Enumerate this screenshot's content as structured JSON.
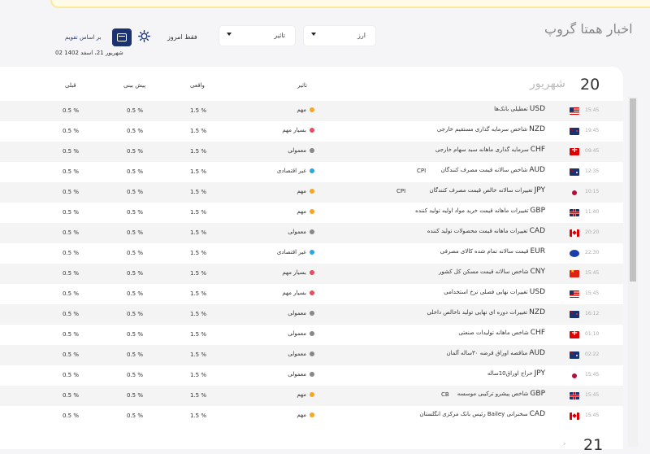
{
  "header": {
    "app_title": "اخبار همتا گروپ",
    "currency_select": "ارز",
    "impact_select": "تاثیر",
    "today_filter": "فقط امروز",
    "by_calendar": "بر اساس تقویم",
    "current_date": "02 شهریور 21، اسفد 1402"
  },
  "columns": {
    "impact": "تاثیر",
    "actual": "واقعی",
    "forecast": "پیش بینی",
    "previous": "قبلی"
  },
  "day": {
    "number": "20",
    "month": "شهریور",
    "next_number": "21"
  },
  "impact_colors": {
    "important": "#f5a623",
    "very_important": "#e84c5e",
    "normal": "#888888",
    "non_economic": "#29a8e0"
  },
  "events": [
    {
      "time": "15:45",
      "flag": "us",
      "currency": "USD",
      "title": "تعطیلی بانک‌ها",
      "code": "",
      "impact": "مهم",
      "impact_color": "#f5a623",
      "actual": "1.5 %",
      "forecast": "0.5 %",
      "previous": "0.5 %"
    },
    {
      "time": "19:45",
      "flag": "nz",
      "currency": "NZD",
      "title": "شاخص سرمایه گذاری مستقیم خارجی",
      "code": "",
      "impact": "بسیار مهم",
      "impact_color": "#e84c5e",
      "actual": "1.5 %",
      "forecast": "0.5 %",
      "previous": "0.5 %"
    },
    {
      "time": "09:45",
      "flag": "ch",
      "currency": "CHF",
      "title": "سرمایه گذاری ماهانه سبد سهام خارجی",
      "code": "",
      "impact": "معمولی",
      "impact_color": "#888888",
      "actual": "1.5 %",
      "forecast": "0.5 %",
      "previous": "0.5 %"
    },
    {
      "time": "12:35",
      "flag": "au",
      "currency": "AUD",
      "title": "شاخص سالانه قیمت مصرف کنندگان",
      "code": "CPI",
      "impact": "غیر اقتصادی",
      "impact_color": "#29a8e0",
      "actual": "1.5 %",
      "forecast": "0.5 %",
      "previous": "0.5 %"
    },
    {
      "time": "10:15",
      "flag": "jp",
      "currency": "JPY",
      "title": "تغییرات سالانه خالص قیمت مصرف کنندگان",
      "code": "CPI",
      "impact": "مهم",
      "impact_color": "#f5a623",
      "actual": "1.5 %",
      "forecast": "0.5 %",
      "previous": "0.5 %"
    },
    {
      "time": "11:40",
      "flag": "gb",
      "currency": "GBP",
      "title": "تغییرات ماهانه قیمت خرید مواد اولیه تولید کننده",
      "code": "",
      "impact": "مهم",
      "impact_color": "#f5a623",
      "actual": "1.5 %",
      "forecast": "0.5 %",
      "previous": "0.5 %"
    },
    {
      "time": "20:20",
      "flag": "ca",
      "currency": "CAD",
      "title": "تغییرات ماهانه قیمت محصولات تولید کننده",
      "code": "",
      "impact": "معمولی",
      "impact_color": "#888888",
      "actual": "1.5 %",
      "forecast": "0.5 %",
      "previous": "0.5 %"
    },
    {
      "time": "22:30",
      "flag": "eu",
      "currency": "EUR",
      "title": "قیمت سالانه تمام شده کالای مصرفی",
      "code": "",
      "impact": "غیر اقتصادی",
      "impact_color": "#29a8e0",
      "actual": "1.5 %",
      "forecast": "0.5 %",
      "previous": "0.5 %"
    },
    {
      "time": "15:45",
      "flag": "cn",
      "currency": "CNY",
      "title": "شاخص سالانه قیمت مسکن کل کشور",
      "code": "",
      "impact": "بسیار مهم",
      "impact_color": "#e84c5e",
      "actual": "1.5 %",
      "forecast": "0.5 %",
      "previous": "0.5 %"
    },
    {
      "time": "15:45",
      "flag": "us",
      "currency": "USD",
      "title": "تغییرات نهایی فصلی نرخ استخدامی",
      "code": "",
      "impact": "بسیار مهم",
      "impact_color": "#e84c5e",
      "actual": "1.5 %",
      "forecast": "0.5 %",
      "previous": "0.5 %"
    },
    {
      "time": "16:12",
      "flag": "nz",
      "currency": "NZD",
      "title": "تغییرات دوره ای نهایی تولید ناخالص داخلی",
      "code": "",
      "impact": "معمولی",
      "impact_color": "#888888",
      "actual": "1.5 %",
      "forecast": "0.5 %",
      "previous": "0.5 %"
    },
    {
      "time": "01:10",
      "flag": "ch",
      "currency": "CHF",
      "title": "شاخص ماهانه تولیدات صنعتی",
      "code": "",
      "impact": "معمولی",
      "impact_color": "#888888",
      "actual": "1.5 %",
      "forecast": "0.5 %",
      "previous": "0.5 %"
    },
    {
      "time": "02:22",
      "flag": "au",
      "currency": "AUD",
      "title": "مناقصه اوراق قرضه ۳۰ساله آلمان",
      "code": "",
      "impact": "معمولی",
      "impact_color": "#888888",
      "actual": "1.5 %",
      "forecast": "0.5 %",
      "previous": "0.5 %"
    },
    {
      "time": "15:45",
      "flag": "jp",
      "currency": "JPY",
      "title": "حراج اوراق10ساله",
      "code": "",
      "impact": "معمولی",
      "impact_color": "#888888",
      "actual": "1.5 %",
      "forecast": "0.5 %",
      "previous": "0.5 %"
    },
    {
      "time": "15:45",
      "flag": "gb",
      "currency": "GBP",
      "title": "شاخص پیشرو ترکیبی موسسه",
      "code": "CB",
      "impact": "مهم",
      "impact_color": "#f5a623",
      "actual": "1.5 %",
      "forecast": "0.5 %",
      "previous": "0.5 %"
    },
    {
      "time": "15:45",
      "flag": "ca",
      "currency": "CAD",
      "title": "سخنرانی Bailey رئیس بانک مرکزی انگلستان",
      "code": "",
      "impact": "مهم",
      "impact_color": "#f5a623",
      "actual": "1.5 %",
      "forecast": "0.5 %",
      "previous": "0.5 %"
    }
  ]
}
